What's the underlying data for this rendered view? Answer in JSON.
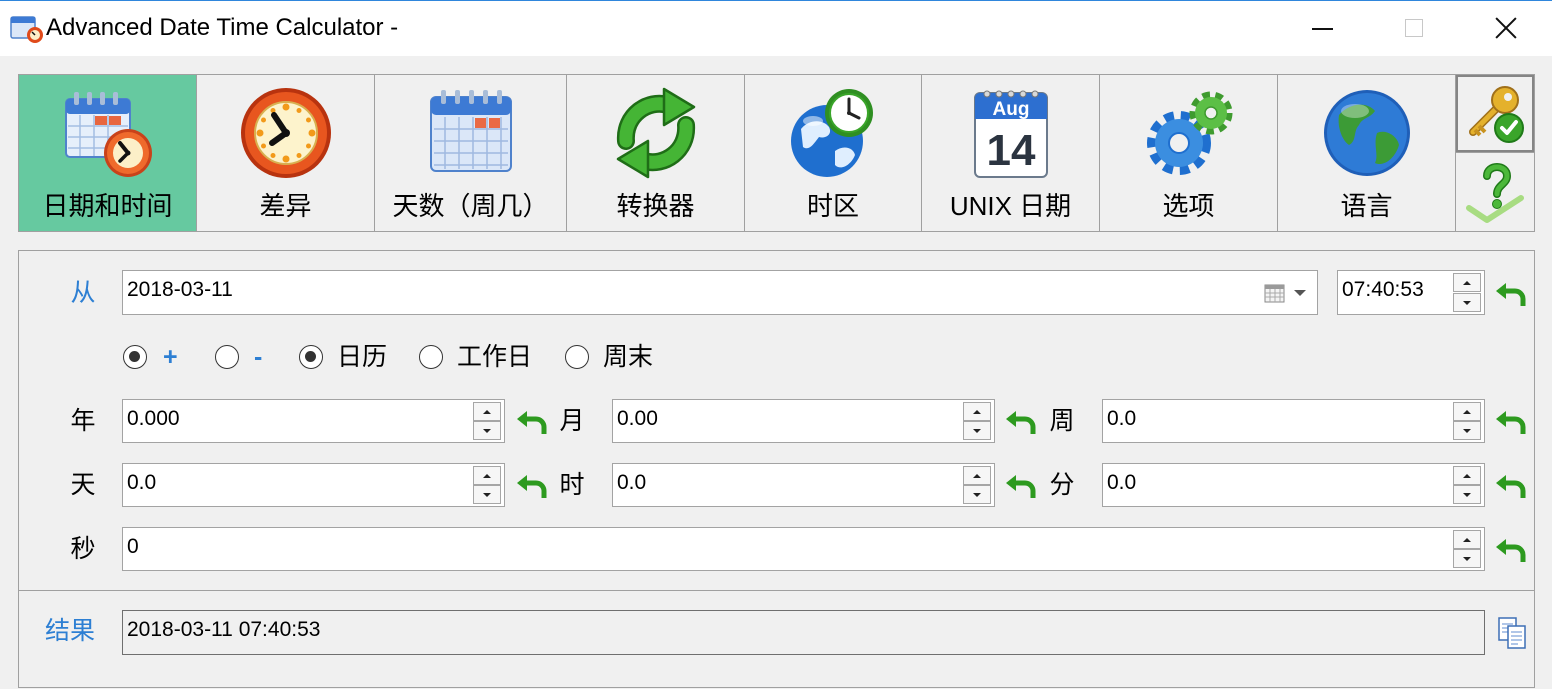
{
  "window": {
    "title": "Advanced Date Time Calculator -",
    "app_icon": "calendar-clock-app-icon",
    "controls": {
      "minimize": "minimize-icon",
      "maximize": "maximize-icon",
      "close": "close-icon"
    }
  },
  "colors": {
    "selected_tab": "#66c9a0",
    "label_blue": "#2d7fd3",
    "reset_green": "#2d9a1f",
    "background": "#f0f0f0"
  },
  "toolbar": {
    "items": [
      {
        "label": "日期和时间",
        "icon": "calendar-clock-icon",
        "selected": true
      },
      {
        "label": "差异",
        "icon": "alarm-clock-icon",
        "selected": false
      },
      {
        "label": "天数（周几）",
        "icon": "calendar-icon",
        "selected": false
      },
      {
        "label": "转换器",
        "icon": "convert-arrows-icon",
        "selected": false
      },
      {
        "label": "时区",
        "icon": "globe-clock-icon",
        "selected": false
      },
      {
        "label": "UNIX 日期",
        "icon": "date-page-icon",
        "icon_month": "Aug",
        "icon_day": "14",
        "selected": false
      },
      {
        "label": "选项",
        "icon": "gears-icon",
        "selected": false
      },
      {
        "label": "语言",
        "icon": "globe-icon",
        "selected": false
      }
    ],
    "side_buttons": [
      {
        "icon": "key-check-icon"
      },
      {
        "icon": "help-icon"
      }
    ]
  },
  "from": {
    "label": "从",
    "date": "2018-03-11",
    "time": "07:40:53",
    "date_picker_icon": "calendar-dropdown-icon"
  },
  "mode": {
    "options": [
      {
        "label": "+",
        "checked": true
      },
      {
        "label": "-",
        "checked": false
      }
    ]
  },
  "day_type": {
    "options": [
      {
        "label": "日历",
        "checked": true
      },
      {
        "label": "工作日",
        "checked": false
      },
      {
        "label": "周末",
        "checked": false
      }
    ]
  },
  "fields": {
    "year": {
      "label": "年",
      "value": "0.000"
    },
    "month": {
      "label": "月",
      "value": "0.00"
    },
    "week": {
      "label": "周",
      "value": "0.0"
    },
    "day": {
      "label": "天",
      "value": "0.0"
    },
    "hour": {
      "label": "时",
      "value": "0.0"
    },
    "minute": {
      "label": "分",
      "value": "0.0"
    },
    "second": {
      "label": "秒",
      "value": "0"
    }
  },
  "reset_icon": "undo-arrow-icon",
  "result": {
    "label": "结果",
    "value": "2018-03-11 07:40:53",
    "copy_icon": "copy-icon"
  }
}
